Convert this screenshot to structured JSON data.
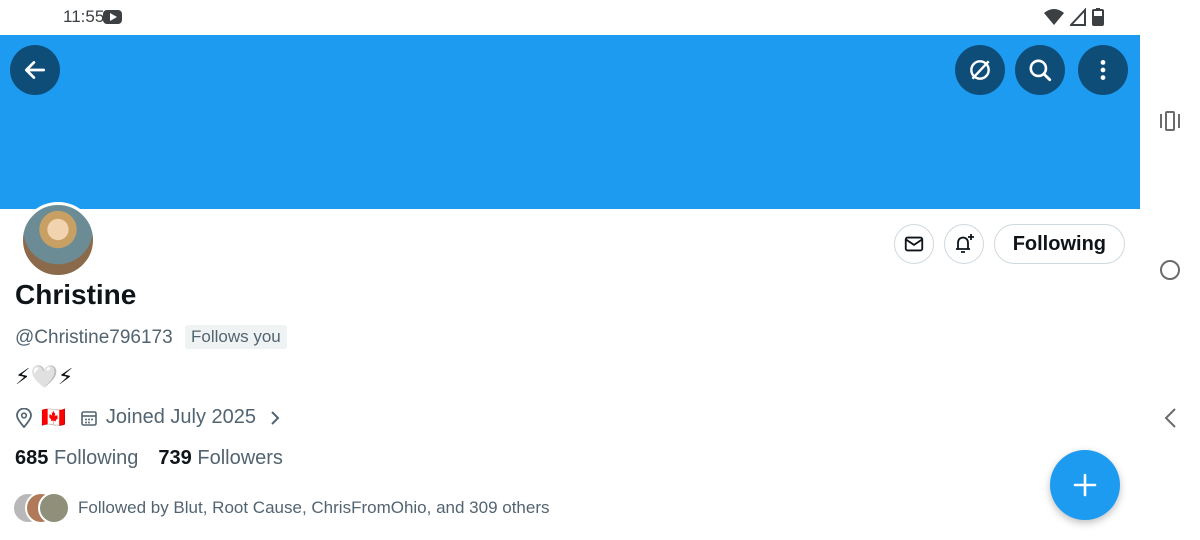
{
  "status_bar": {
    "time": "11:55",
    "icons": [
      "youtube-icon",
      "wifi-icon",
      "signal-icon",
      "battery-icon"
    ]
  },
  "header": {
    "back_icon": "arrow-left-icon",
    "grok_icon": "grok-icon",
    "search_icon": "search-icon",
    "more_icon": "more-vertical-icon",
    "banner_color": "#1d9bf0"
  },
  "profile": {
    "name": "Christine",
    "handle": "@Christine796173",
    "follows_you": "Follows you",
    "bio": "⚡🤍⚡",
    "location_flag": "🇨🇦",
    "joined": "Joined July 2025",
    "following_count": "685",
    "following_label": "Following",
    "followers_count": "739",
    "followers_label": "Followers",
    "followed_by": "Followed by Blut, Root Cause, ChrisFromOhio, and 309 others"
  },
  "actions": {
    "message_icon": "mail-icon",
    "notify_icon": "bell-plus-icon",
    "following_button": "Following"
  },
  "fab": {
    "icon": "plus-icon",
    "color": "#1d9bf0"
  },
  "system_nav": [
    "recents-icon",
    "home-icon",
    "back-icon"
  ]
}
